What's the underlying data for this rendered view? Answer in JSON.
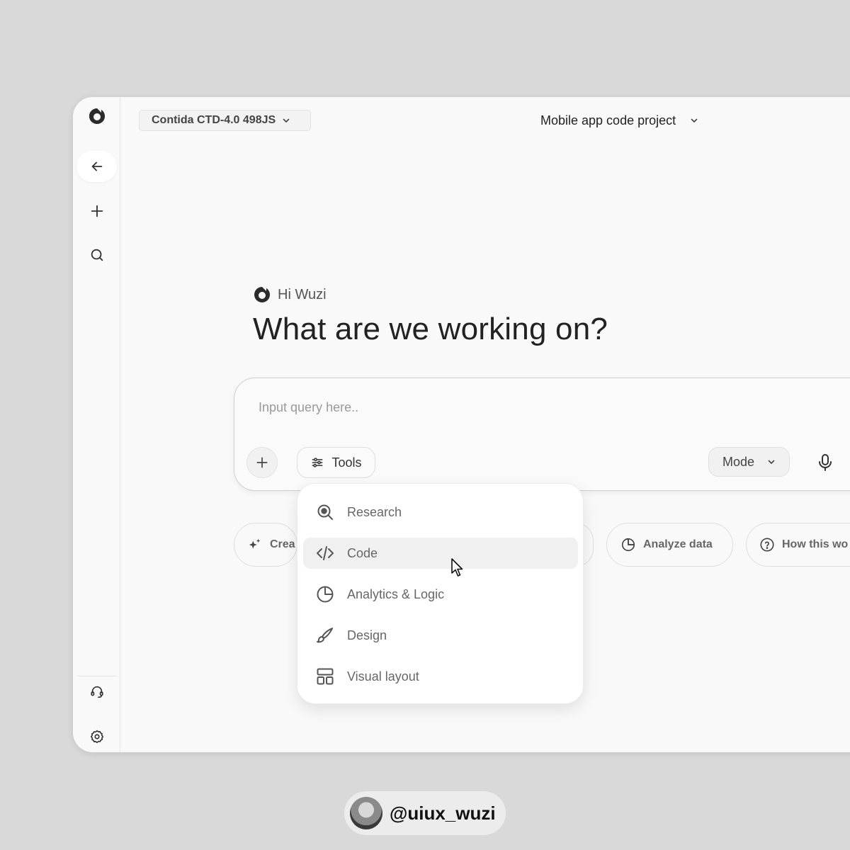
{
  "top_bar": {
    "model_label": "Contida CTD-4.0 498JS",
    "project_label": "Mobile app code project"
  },
  "sidebar": {
    "items": [
      {
        "name": "back",
        "icon": "arrow-left-icon"
      },
      {
        "name": "new",
        "icon": "plus-icon"
      },
      {
        "name": "search",
        "icon": "search-icon"
      },
      {
        "name": "support",
        "icon": "headset-icon"
      },
      {
        "name": "settings",
        "icon": "gear-icon"
      }
    ]
  },
  "main": {
    "greeting": "Hi Wuzi",
    "headline": "What are we working on?"
  },
  "composer": {
    "placeholder": "Input query here..",
    "tools_label": "Tools",
    "mode_label": "Mode"
  },
  "suggestions": [
    {
      "label": "Crea",
      "icon": "sparkles-icon"
    },
    {
      "label": "Analyze data",
      "icon": "pie-chart-icon"
    },
    {
      "label": "How this wo",
      "icon": "question-circle-icon"
    }
  ],
  "tools_menu": {
    "items": [
      {
        "label": "Research",
        "icon": "research-icon"
      },
      {
        "label": "Code",
        "icon": "code-icon",
        "active": true
      },
      {
        "label": "Analytics & Logic",
        "icon": "pie-chart-icon"
      },
      {
        "label": "Design",
        "icon": "brush-icon"
      },
      {
        "label": "Visual layout",
        "icon": "layout-icon"
      }
    ]
  },
  "footer": {
    "handle": "@uiux_wuzi"
  },
  "colors": {
    "background": "#d9d9d9",
    "window": "#f9f9f9",
    "text": "#222222",
    "muted": "#666666",
    "active_item": "#f0f0f0"
  }
}
